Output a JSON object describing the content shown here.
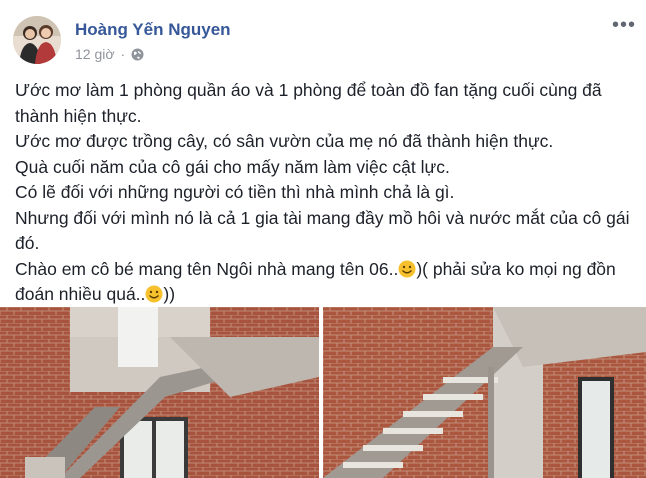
{
  "post": {
    "author": "Hoàng Yến Nguyen",
    "time": "12 giờ",
    "privacy_icon": "globe-icon",
    "more_icon": "ellipsis-icon",
    "lines": [
      "Ước mơ làm 1 phòng quần áo và 1 phòng để toàn đồ fan tặng cuối cùng đã thành hiện thực.",
      "Ước mơ được trồng cây, có sân vườn của mẹ nó đã thành hiện thực.",
      "Quà cuối năm của cô gái cho mấy năm làm việc cật lực.",
      "Có lẽ đối với những người có tiền thì nhà mình chả là gì.",
      "Nhưng đối với mình nó là cả 1 gia tài mang đầy mồ hôi và nước mắt của cô gái đó."
    ],
    "last_line": {
      "part1": "Chào em cô bé mang tên Ngôi nhà mang tên 06..",
      "part2": ")( phải sửa ko mọi ng đồn đoán nhiều quá..",
      "part3": "))"
    },
    "emoji_icon": "smiley-icon",
    "photos": [
      "staircase-photo-left",
      "staircase-photo-right"
    ]
  }
}
